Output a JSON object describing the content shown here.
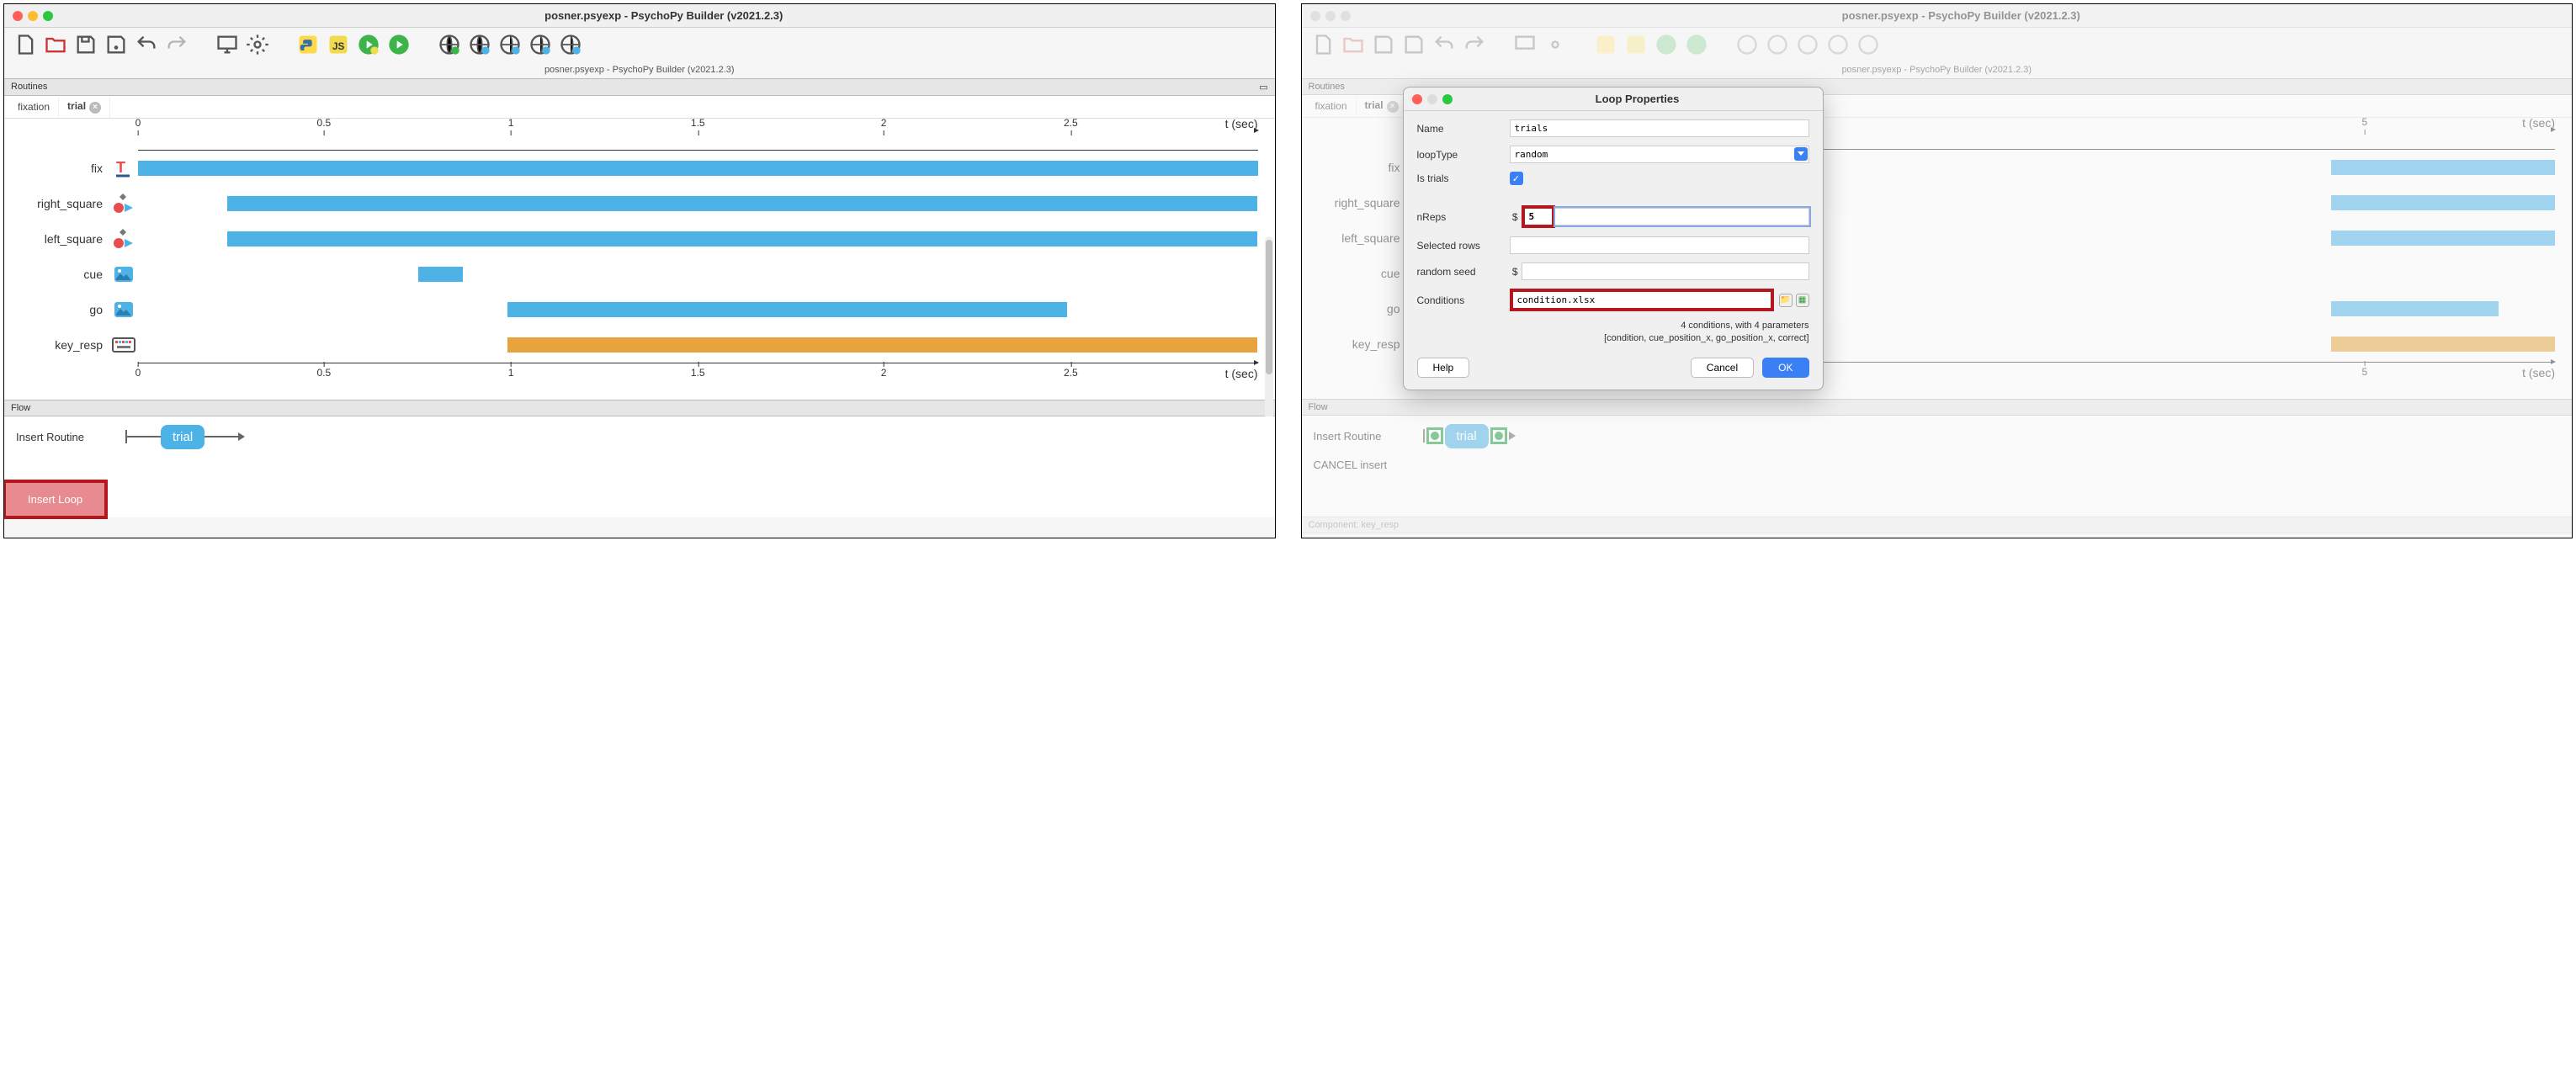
{
  "left": {
    "title": "posner.psyexp - PsychoPy Builder (v2021.2.3)",
    "subtitle": "posner.psyexp - PsychoPy Builder (v2021.2.3)",
    "routines_header": "Routines",
    "tabs": {
      "fixation": "fixation",
      "trial": "trial"
    },
    "axis": {
      "ticks": [
        "0",
        "0.5",
        "1",
        "1.5",
        "2",
        "2.5"
      ],
      "label": "t (sec)"
    },
    "components": {
      "fix": "fix",
      "right_square": "right_square",
      "left_square": "left_square",
      "cue": "cue",
      "go": "go",
      "key_resp": "key_resp"
    },
    "flow_header": "Flow",
    "insert_routine": "Insert Routine",
    "trial_box": "trial",
    "insert_loop": "Insert Loop"
  },
  "right": {
    "title": "posner.psyexp - PsychoPy Builder (v2021.2.3)",
    "subtitle": "posner.psyexp - PsychoPy Builder (v2021.2.3)",
    "routines_header": "Routines",
    "tabs": {
      "fixation": "fixation",
      "trial": "trial"
    },
    "axis": {
      "tick5": "5",
      "label": "t (sec)"
    },
    "components": {
      "fix": "fix",
      "right_square": "right_square",
      "left_square": "left_square",
      "cue": "cue",
      "go": "go",
      "key_resp": "key_resp"
    },
    "flow_header": "Flow",
    "insert_routine": "Insert Routine",
    "cancel_insert": "CANCEL insert",
    "trial_box": "trial",
    "component_footer": "Component: key_resp",
    "dialog": {
      "title": "Loop Properties",
      "name_label": "Name",
      "name_value": "trials",
      "looptype_label": "loopType",
      "looptype_value": "random",
      "istrials_label": "Is trials",
      "nreps_label": "nReps",
      "nreps_value": "5",
      "selrows_label": "Selected rows",
      "seed_label": "random seed",
      "conditions_label": "Conditions",
      "conditions_value": "condition.xlsx",
      "conditions_summary1": "4 conditions, with 4 parameters",
      "conditions_summary2": "[condition, cue_position_x, go_position_x, correct]",
      "help": "Help",
      "cancel": "Cancel",
      "ok": "OK"
    }
  },
  "chart_data": {
    "type": "bar",
    "xlabel": "t (sec)",
    "xlim": [
      0,
      3
    ],
    "ticks": [
      0,
      0.5,
      1,
      1.5,
      2,
      2.5
    ],
    "components": [
      {
        "name": "fix",
        "start": 0.0,
        "end": 3.0,
        "kind": "text"
      },
      {
        "name": "right_square",
        "start": 0.25,
        "end": 3.0,
        "kind": "polygon"
      },
      {
        "name": "left_square",
        "start": 0.25,
        "end": 3.0,
        "kind": "polygon"
      },
      {
        "name": "cue",
        "start": 0.75,
        "end": 0.85,
        "kind": "image"
      },
      {
        "name": "go",
        "start": 1.0,
        "end": 2.5,
        "kind": "image"
      },
      {
        "name": "key_resp",
        "start": 1.0,
        "end": 3.0,
        "kind": "keyboard"
      }
    ]
  }
}
